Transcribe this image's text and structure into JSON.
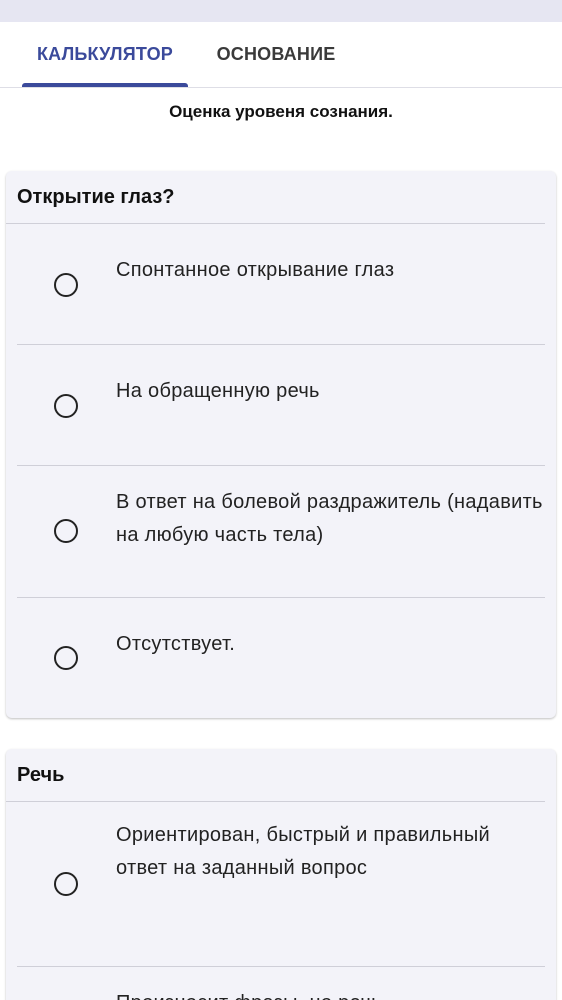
{
  "tabs": {
    "calculator": "КАЛЬКУЛЯТОР",
    "basis": "ОСНОВАНИЕ"
  },
  "subtitle": "Оценка уровеня сознания.",
  "eyes": {
    "title": "Открытие глаз?",
    "options": [
      "Спонтанное открывание глаз",
      "На обращенную речь",
      "В ответ на болевой раздражитель (надавить на любую часть тела)",
      "Отсутствует."
    ]
  },
  "speech": {
    "title": "Речь",
    "options": [
      "Ориентирован, быстрый и правильный ответ на заданный вопрос",
      "Произносит фразы, но речь"
    ]
  },
  "colors": {
    "accent": "#3b4a9b",
    "card_bg": "#f3f3f9",
    "status_strip": "#e6e6f2"
  }
}
